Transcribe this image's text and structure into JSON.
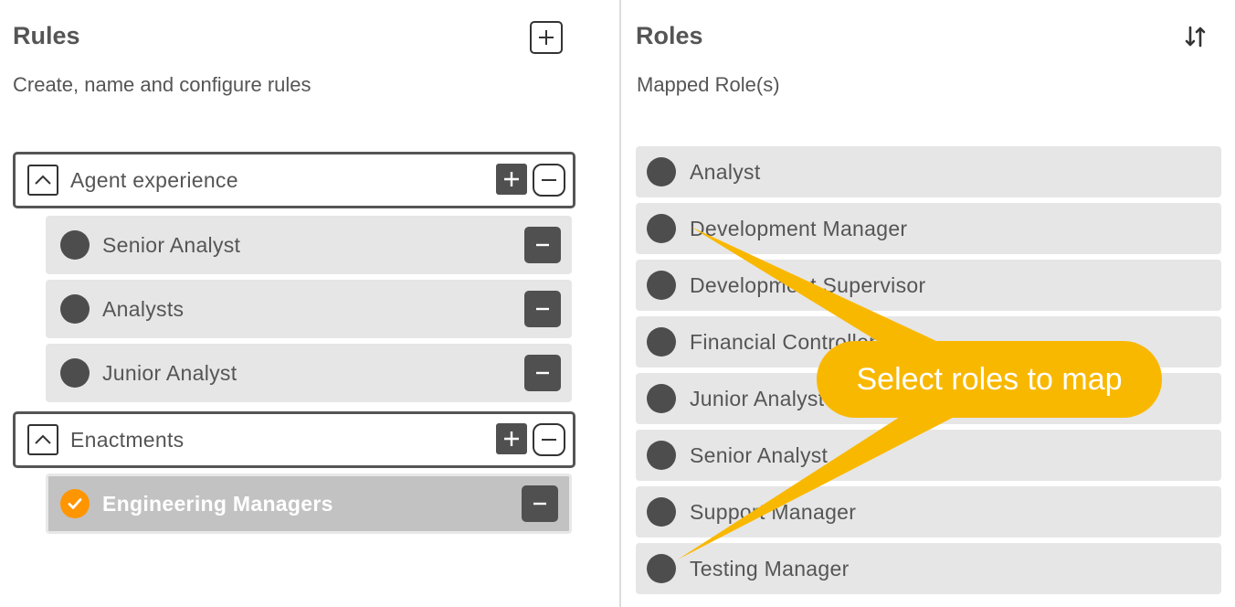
{
  "rules_panel": {
    "title": "Rules",
    "subtitle": "Create, name and configure rules",
    "groups": [
      {
        "label": "Agent experience",
        "items": [
          {
            "label": "Senior Analyst",
            "selected": false
          },
          {
            "label": "Analysts",
            "selected": false
          },
          {
            "label": "Junior Analyst",
            "selected": false
          }
        ]
      },
      {
        "label": "Enactments",
        "items": [
          {
            "label": "Engineering Managers",
            "selected": true
          }
        ]
      }
    ]
  },
  "roles_panel": {
    "title": "Roles",
    "subtitle": "Mapped Role(s)",
    "roles": [
      {
        "label": "Analyst"
      },
      {
        "label": "Development Manager"
      },
      {
        "label": "Development Supervisor"
      },
      {
        "label": "Financial Controller"
      },
      {
        "label": "Junior Analyst"
      },
      {
        "label": "Senior Analyst"
      },
      {
        "label": "Support Manager"
      },
      {
        "label": "Testing Manager"
      }
    ]
  },
  "callout": {
    "text": "Select roles to map",
    "color": "#f9b800"
  },
  "colors": {
    "selected_check": "#ff9500",
    "dark_button": "#505050",
    "item_bg": "#e6e6e6",
    "selected_bg": "#c2c2c2"
  }
}
